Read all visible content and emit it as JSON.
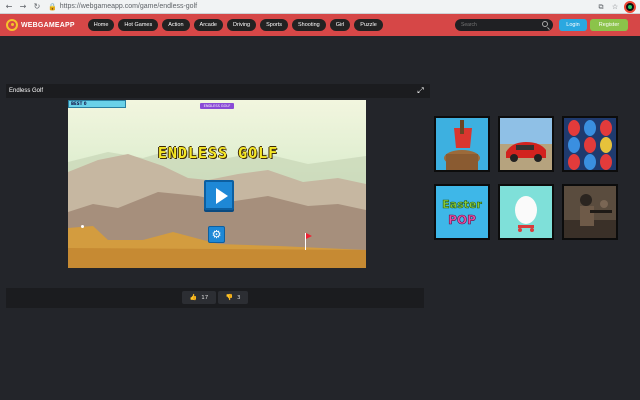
{
  "browser": {
    "url": "https://webgameapp.com/game/endless-golf"
  },
  "site": {
    "logo_text": "WEBGAMEAPP",
    "menu": [
      {
        "label": "Home"
      },
      {
        "label": "Hot Games"
      },
      {
        "label": "Action"
      },
      {
        "label": "Arcade"
      },
      {
        "label": "Driving"
      },
      {
        "label": "Sports"
      },
      {
        "label": "Shooting"
      },
      {
        "label": "Girl"
      },
      {
        "label": "Puzzle"
      }
    ],
    "search_placeholder": "Search",
    "login_label": "Login",
    "register_label": "Register",
    "colors": {
      "header": "#d64747",
      "login": "#2aa8e0",
      "register": "#8bc34a"
    }
  },
  "game": {
    "title": "Endless Golf",
    "logo_text": "ENDLESS GOLF",
    "best_label": "BEST 0",
    "promo_label": "ENDLESS GOLF",
    "likes": "17",
    "dislikes": "3"
  },
  "related": [
    {
      "name": "axe-game",
      "icon": "axe-icon"
    },
    {
      "name": "red-car-game",
      "icon": "car-icon"
    },
    {
      "name": "easter-eggs-game",
      "icon": "eggs-icon"
    },
    {
      "name": "easter-pop-game",
      "icon": "easter-pop-icon",
      "label": "Easter POP"
    },
    {
      "name": "egg-game",
      "icon": "egg-icon"
    },
    {
      "name": "soldier-game",
      "icon": "soldier-icon"
    }
  ]
}
